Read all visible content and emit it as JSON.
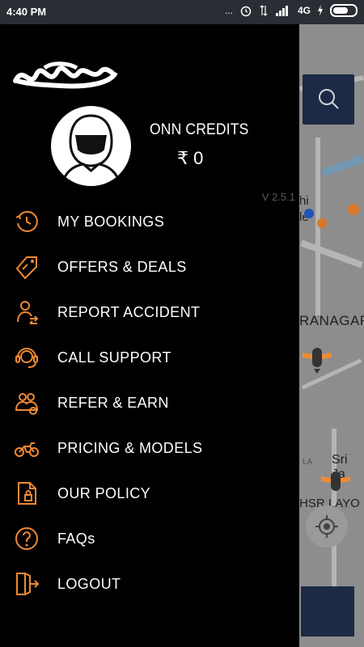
{
  "status_bar": {
    "time": "4:40 PM",
    "dots": "...",
    "network": "4G"
  },
  "drawer": {
    "credits_title": "ONN CREDITS",
    "credits_value": "₹ 0",
    "version": "V 2.5.1",
    "menu": [
      {
        "label": "MY BOOKINGS",
        "icon": "booking-history-icon"
      },
      {
        "label": "OFFERS & DEALS",
        "icon": "offers-tag-icon"
      },
      {
        "label": "REPORT ACCIDENT",
        "icon": "report-accident-icon"
      },
      {
        "label": "CALL SUPPORT",
        "icon": "headset-icon"
      },
      {
        "label": "REFER & EARN",
        "icon": "refer-people-icon"
      },
      {
        "label": "PRICING & MODELS",
        "icon": "motorcycle-icon"
      },
      {
        "label": "OUR POLICY",
        "icon": "policy-document-icon"
      },
      {
        "label": "FAQs",
        "icon": "question-icon"
      },
      {
        "label": "LOGOUT",
        "icon": "logout-icon"
      }
    ]
  },
  "map": {
    "labels": [
      "hi",
      "le",
      "RANAGAR",
      "Sri Ja",
      "LA",
      "HSR LAYO"
    ]
  },
  "colors": {
    "accent": "#f08a32",
    "drawer_bg": "#000000",
    "map_button": "#1c2a45",
    "status_bar": "#2a2d33"
  }
}
